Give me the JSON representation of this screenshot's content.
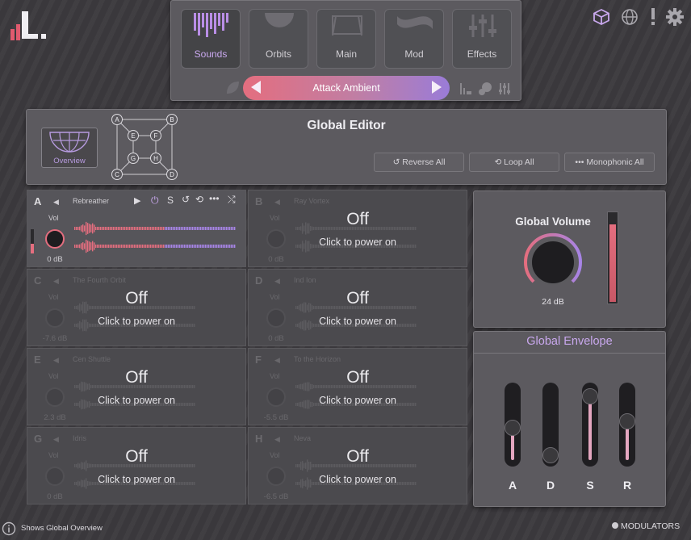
{
  "top_tabs": [
    {
      "label": "Sounds",
      "active": true
    },
    {
      "label": "Orbits",
      "active": false
    },
    {
      "label": "Main",
      "active": false
    },
    {
      "label": "Mod",
      "active": false
    },
    {
      "label": "Effects",
      "active": false
    }
  ],
  "preset": {
    "name": "Attack Ambient"
  },
  "editor": {
    "title": "Global Editor",
    "overview_label": "Overview",
    "grid_nodes": [
      "A",
      "B",
      "C",
      "D",
      "E",
      "F",
      "G",
      "H"
    ],
    "buttons": {
      "reverse": "Reverse All",
      "loop": "Loop All",
      "mono": "Monophonic All"
    }
  },
  "slots": [
    {
      "letter": "A",
      "name": "Rebreather",
      "vol_label": "Vol",
      "db": "0 dB",
      "on": true
    },
    {
      "letter": "B",
      "name": "Ray Vortex",
      "vol_label": "Vol",
      "db": "0 dB",
      "off_text": "Off",
      "power_text": "Click to power on"
    },
    {
      "letter": "C",
      "name": "The Fourth Orbit",
      "vol_label": "Vol",
      "db": "-7.6 dB",
      "off_text": "Off",
      "power_text": "Click to power on"
    },
    {
      "letter": "D",
      "name": "Ind Ion",
      "vol_label": "Vol",
      "db": "0 dB",
      "off_text": "Off",
      "power_text": "Click to power on"
    },
    {
      "letter": "E",
      "name": "Cen Shuttle",
      "vol_label": "Vol",
      "db": "2.3 dB",
      "off_text": "Off",
      "power_text": "Click to power on"
    },
    {
      "letter": "F",
      "name": "To the Horizon",
      "vol_label": "Vol",
      "db": "-5.5 dB",
      "off_text": "Off",
      "power_text": "Click to power on"
    },
    {
      "letter": "G",
      "name": "Idris",
      "vol_label": "Vol",
      "db": "0 dB",
      "off_text": "Off",
      "power_text": "Click to power on"
    },
    {
      "letter": "H",
      "name": "Neva",
      "vol_label": "Vol",
      "db": "-6.5 dB",
      "off_text": "Off",
      "power_text": "Click to power on"
    }
  ],
  "slot_a_controls": {
    "solo": "S"
  },
  "global_volume": {
    "title": "Global Volume",
    "value": "24 dB",
    "level": 0.85
  },
  "global_envelope": {
    "title": "Global Envelope",
    "sliders": [
      {
        "label": "A",
        "value": 0.45
      },
      {
        "label": "D",
        "value": 0.05
      },
      {
        "label": "S",
        "value": 0.92
      },
      {
        "label": "R",
        "value": 0.55
      }
    ]
  },
  "status": {
    "hint": "Shows Global Overview",
    "modulators": "MODULATORS"
  },
  "colors": {
    "accent": "#c9a8ee",
    "pink": "#e4a6c0",
    "gradient_start": "#e46e7f",
    "gradient_end": "#9a7cd8"
  }
}
